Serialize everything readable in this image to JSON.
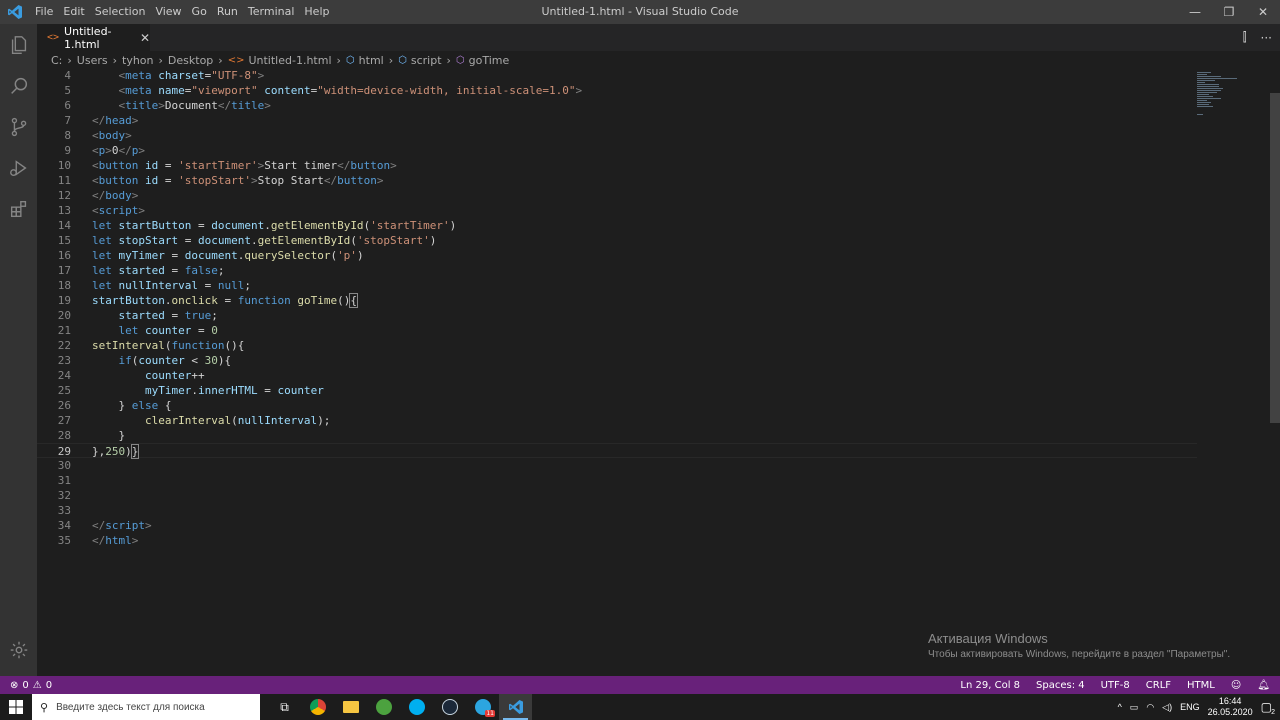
{
  "titlebar": {
    "menu": [
      "File",
      "Edit",
      "Selection",
      "View",
      "Go",
      "Run",
      "Terminal",
      "Help"
    ],
    "title": "Untitled-1.html - Visual Studio Code",
    "controls": [
      "—",
      "❐",
      "✕"
    ]
  },
  "activitybar": {
    "icons": [
      "files-icon",
      "search-icon",
      "source-control-icon",
      "run-debug-icon",
      "extensions-icon"
    ],
    "settings_icon": "gear-icon"
  },
  "tab": {
    "icon": "<>",
    "label": "Untitled-1.html",
    "close": "✕"
  },
  "tab_actions": [
    "⫿",
    "···"
  ],
  "breadcrumb": {
    "items": [
      "C:",
      "Users",
      "tyhon",
      "Desktop",
      "Untitled-1.html",
      "html",
      "script",
      "goTime"
    ],
    "separator": "›"
  },
  "editor": {
    "line_numbers": [
      "4",
      "5",
      "6",
      "7",
      "8",
      "9",
      "10",
      "11",
      "12",
      "13",
      "14",
      "15",
      "16",
      "17",
      "18",
      "19",
      "20",
      "21",
      "22",
      "23",
      "24",
      "25",
      "26",
      "27",
      "28",
      "29",
      "30",
      "31",
      "32",
      "33",
      "34",
      "35"
    ],
    "current_line": "29"
  },
  "watermark": {
    "title": "Активация Windows",
    "subtitle": "Чтобы активировать Windows, перейдите в раздел \"Параметры\"."
  },
  "statusbar": {
    "errors": "0",
    "warnings": "0",
    "position": "Ln 29, Col 8",
    "spaces": "Spaces: 4",
    "encoding": "UTF-8",
    "eol": "CRLF",
    "language": "HTML"
  },
  "taskbar": {
    "search_placeholder": "Введите здесь текст для поиска",
    "apps": [
      "task-view-icon",
      "chrome-icon",
      "file-explorer-icon",
      "utorrent-icon",
      "skype-icon",
      "steam-icon",
      "telegram-icon",
      "vscode-icon"
    ],
    "telegram_badge": "11",
    "language": "ENG",
    "time": "16:44",
    "date": "26.05.2020",
    "notification_count": "2"
  },
  "colors": {
    "statusbar_bg": "#68217a",
    "editor_bg": "#1e1e1e",
    "titlebar_bg": "#3c3c3c",
    "activitybar_bg": "#333333"
  }
}
